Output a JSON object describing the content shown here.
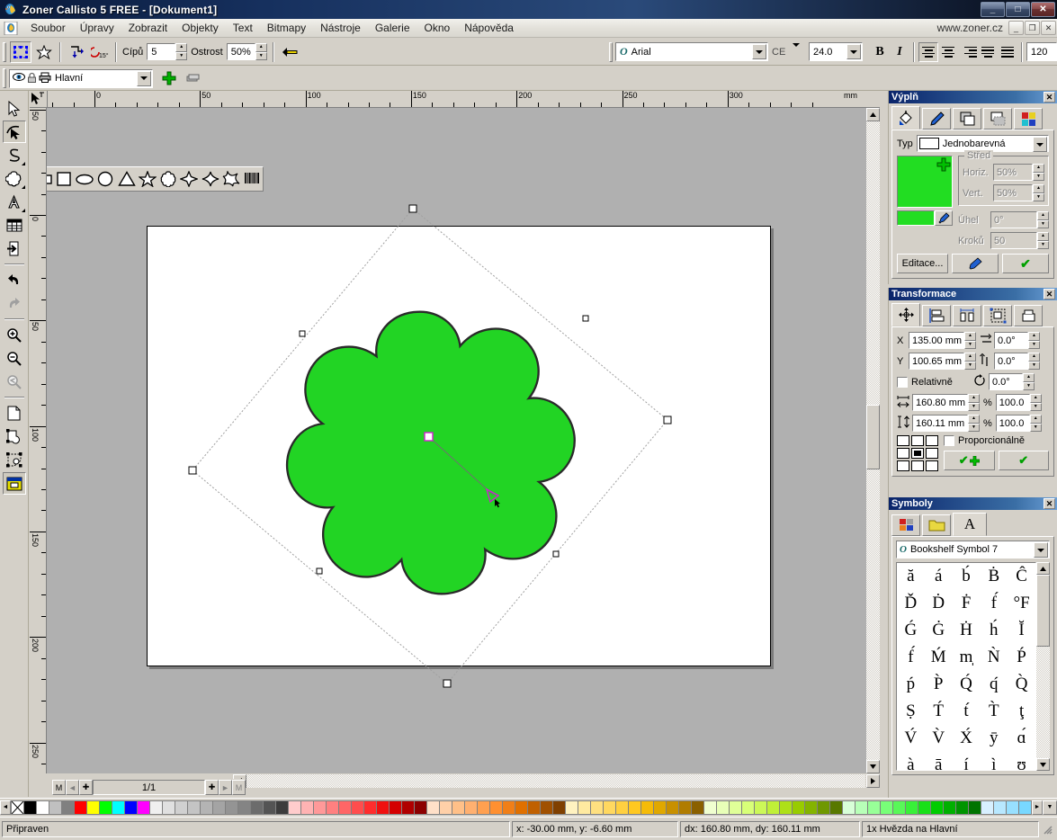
{
  "window": {
    "title": "Zoner Callisto 5 FREE - [Dokument1]",
    "minimize": "_",
    "maximize": "□",
    "close": "✕",
    "url": "www.zoner.cz",
    "mdi_min": "_",
    "mdi_restore": "❐",
    "mdi_close": "✕"
  },
  "menu": {
    "items": [
      "Soubor",
      "Úpravy",
      "Zobrazit",
      "Objekty",
      "Text",
      "Bitmapy",
      "Nástroje",
      "Galerie",
      "Okno",
      "Nápověda"
    ]
  },
  "toolbar": {
    "cipu_label": "Cípů",
    "cipu_value": "5",
    "ostrost_label": "Ostrost",
    "ostrost_value": "50%",
    "font_name": "Arial",
    "charset": "CE",
    "font_size": "24.0",
    "bold": "B",
    "italic": "I",
    "spacing_value": "120",
    "up_arrow": "▲",
    "down_arrow": "▼"
  },
  "layerbar": {
    "layer_name": "Hlavní"
  },
  "rulers": {
    "unit": "mm",
    "h_labels": [
      "50",
      "0",
      "50",
      "100",
      "150",
      "200",
      "250",
      "300"
    ],
    "v_labels": [
      "50",
      "0",
      "50",
      "100",
      "150",
      "200",
      "250"
    ]
  },
  "canvas": {
    "shape": {
      "name": "star-clover",
      "fill": "#22d424",
      "stroke": "#1a1a1a",
      "points": 8,
      "rotation_deg": 0
    },
    "selection": {
      "handle_count": 8,
      "rotation_center_color": "#d020d0"
    }
  },
  "shape_palette": {
    "tools": [
      "rectangle-tool",
      "square-tool",
      "ellipse-tool",
      "circle-tool",
      "triangle-tool",
      "star5-tool",
      "flower-tool",
      "diamond4-tool",
      "sparkle-tool",
      "spiky-star-tool",
      "barcode-tool"
    ]
  },
  "pagenav": {
    "first": "M",
    "prev": "◄",
    "add_prev": "✚",
    "page_indicator": "1/1",
    "add_next": "✚",
    "next": "►",
    "last": "M",
    "scroll_left": "◄"
  },
  "panels": {
    "fill": {
      "title": "Výplň",
      "close": "✕",
      "tabs": [
        "fill-tab",
        "outline-tab",
        "transparency-tab",
        "shadow-tab",
        "color-tab"
      ],
      "typ_label": "Typ",
      "typ_value": "Jednobarevná",
      "color": "#22dd22",
      "stred_label": "Střed",
      "horiz_label": "Horiz.",
      "horiz_value": "50%",
      "vert_label": "Vert.",
      "vert_value": "50%",
      "uhel_label": "Úhel",
      "uhel_value": "0°",
      "kroku_label": "Kroků",
      "kroku_value": "50",
      "editace_button": "Editace...",
      "pipette_button": "eyedropper-icon",
      "apply_button": "✔"
    },
    "transform": {
      "title": "Transformace",
      "close": "✕",
      "tabs": [
        "move-tab",
        "align-tab",
        "distribute-tab",
        "fit-tab",
        "duplicate-tab"
      ],
      "x_label": "X",
      "x_value": "135.00 mm",
      "y_label": "Y",
      "y_value": "100.65 mm",
      "skew_h_value": "0.0°",
      "skew_v_value": "0.0°",
      "rotate_value": "0.0°",
      "relative_label": "Relativně",
      "width_value": "160.80 mm",
      "width_pct_label": "%",
      "width_pct": "100.0",
      "height_value": "160.11 mm",
      "height_pct_label": "%",
      "height_pct": "100.0",
      "proportional_label": "Proporcionálně",
      "apply_copy_button": "✔",
      "apply_button": "✔"
    },
    "symbols": {
      "title": "Symboly",
      "close": "✕",
      "tabs": [
        "palette-tab",
        "folder-tab",
        "font-tab"
      ],
      "font_name": "Bookshelf Symbol 7",
      "glyphs": [
        "ă",
        "á",
        "b́",
        "Ḃ",
        "Ĉ",
        "Ď",
        "Ḋ",
        "Ḟ",
        "f́",
        "°F",
        "Ǵ",
        "Ġ",
        "Ḣ",
        "h́",
        "Ĭ",
        "f́",
        "Ḿ",
        "m̩",
        "Ǹ",
        "Ṕ",
        "ṕ",
        "P̀",
        "Q́",
        "q́",
        "Q̀",
        "Ṣ",
        "T́",
        "t́",
        "T̀",
        "ţ",
        "V́",
        "V̀",
        "X́",
        "ȳ",
        "ɑ́",
        "à",
        "ā",
        "í",
        "ì",
        "ʊ"
      ]
    }
  },
  "statusbar": {
    "state": "Připraven",
    "coords": "x: -30.00 mm, y: -6.60 mm",
    "delta": "dx: 160.80 mm, dy: 160.11 mm",
    "object": "1x Hvězda na Hlavní"
  },
  "palette_colors": [
    "#000000",
    "#ffffff",
    "#c0c0c0",
    "#808080",
    "#ff0000",
    "#ffff00",
    "#00ff00",
    "#00ffff",
    "#0000ff",
    "#ff00ff",
    "#f0f0f0",
    "#e0e0e0",
    "#d0d0d0",
    "#c4c4c4",
    "#b4b4b4",
    "#a4a4a4",
    "#949494",
    "#848484",
    "#6c6c6c",
    "#545454",
    "#3c3c3c",
    "#ffcccc",
    "#ffb3b3",
    "#ff9999",
    "#ff8080",
    "#ff6666",
    "#ff4d4d",
    "#ff2d2d",
    "#f01010",
    "#d40000",
    "#b00000",
    "#8c0000",
    "#ffe0c8",
    "#ffd0a8",
    "#ffc088",
    "#ffb070",
    "#ffa050",
    "#ff9030",
    "#f07f18",
    "#e07000",
    "#c06000",
    "#a05000",
    "#804000",
    "#fff2c0",
    "#ffeaa0",
    "#ffe080",
    "#ffd860",
    "#ffd040",
    "#ffc820",
    "#f5bb08",
    "#e0a800",
    "#c89000",
    "#b07c00",
    "#8a6000",
    "#f0ffd0",
    "#e8ffb8",
    "#e0ff98",
    "#d8ff78",
    "#ccf858",
    "#c0f038",
    "#aee018",
    "#98cc00",
    "#84b400",
    "#6f9800",
    "#587800",
    "#d8ffd8",
    "#b8ffb8",
    "#98ff98",
    "#78ff78",
    "#58f858",
    "#38f038",
    "#18e018",
    "#00cc00",
    "#00b000",
    "#009400",
    "#007400",
    "#d8f0ff",
    "#b8e8ff",
    "#98e0ff",
    "#78d8ff",
    "#58c8f8",
    "#38b8f0",
    "#18a8e8",
    "#0098dc",
    "#0080c0",
    "#0068a0",
    "#005080"
  ]
}
